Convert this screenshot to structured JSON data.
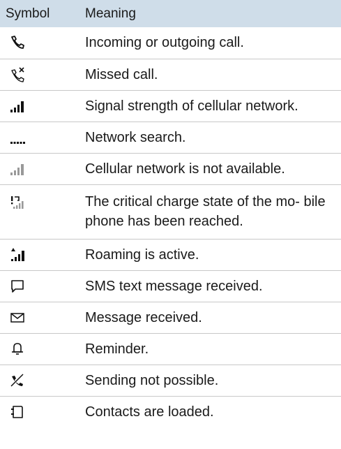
{
  "header": {
    "symbol": "Symbol",
    "meaning": "Meaning"
  },
  "rows": [
    {
      "icon": "phone-handset-icon",
      "meaning": "Incoming or outgoing call."
    },
    {
      "icon": "missed-call-icon",
      "meaning": "Missed call."
    },
    {
      "icon": "signal-strength-icon",
      "meaning": "Signal strength of cellular network."
    },
    {
      "icon": "network-search-icon",
      "meaning": "Network search."
    },
    {
      "icon": "signal-unavailable-icon",
      "meaning": "Cellular network is not available."
    },
    {
      "icon": "critical-charge-icon",
      "meaning": "The critical charge state of the mo- bile phone has been reached."
    },
    {
      "icon": "roaming-icon",
      "meaning": "Roaming is active."
    },
    {
      "icon": "sms-bubble-icon",
      "meaning": "SMS text message received."
    },
    {
      "icon": "envelope-icon",
      "meaning": "Message received."
    },
    {
      "icon": "bell-icon",
      "meaning": "Reminder."
    },
    {
      "icon": "sending-not-possible-icon",
      "meaning": "Sending not possible."
    },
    {
      "icon": "contacts-icon",
      "meaning": "Contacts are loaded."
    }
  ]
}
